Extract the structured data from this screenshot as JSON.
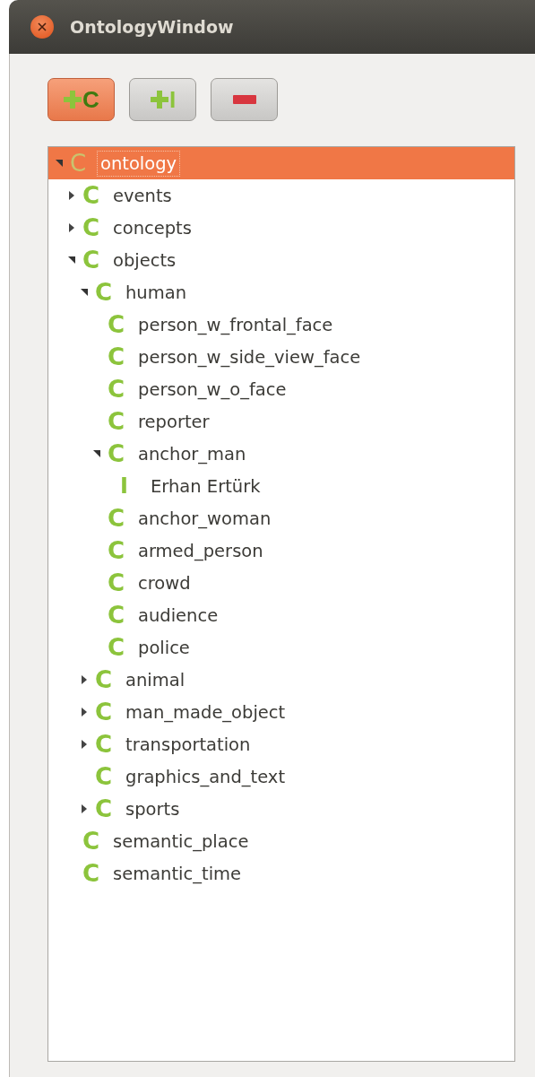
{
  "window": {
    "title": "OntologyWindow"
  },
  "toolbar": [
    {
      "kind": "add",
      "letter": "C",
      "selected": true
    },
    {
      "kind": "add",
      "letter": "I",
      "selected": false
    },
    {
      "kind": "remove",
      "selected": false
    }
  ],
  "tree": [
    {
      "icon": "C",
      "label": "ontology",
      "selected": true,
      "expanded": true,
      "children": [
        {
          "icon": "C",
          "label": "events",
          "selected": false,
          "expanded": false
        },
        {
          "icon": "C",
          "label": "concepts",
          "selected": false,
          "expanded": false
        },
        {
          "icon": "C",
          "label": "objects",
          "selected": false,
          "expanded": true,
          "children": [
            {
              "icon": "C",
              "label": "human",
              "selected": false,
              "expanded": true,
              "children": [
                {
                  "icon": "C",
                  "label": "person_w_frontal_face",
                  "selected": false
                },
                {
                  "icon": "C",
                  "label": "person_w_side_view_face",
                  "selected": false
                },
                {
                  "icon": "C",
                  "label": "person_w_o_face",
                  "selected": false
                },
                {
                  "icon": "C",
                  "label": "reporter",
                  "selected": false
                },
                {
                  "icon": "C",
                  "label": "anchor_man",
                  "selected": false,
                  "expanded": true,
                  "children": [
                    {
                      "icon": "I",
                      "label": "Erhan Ertürk",
                      "selected": false
                    }
                  ]
                },
                {
                  "icon": "C",
                  "label": "anchor_woman",
                  "selected": false
                },
                {
                  "icon": "C",
                  "label": "armed_person",
                  "selected": false
                },
                {
                  "icon": "C",
                  "label": "crowd",
                  "selected": false
                },
                {
                  "icon": "C",
                  "label": "audience",
                  "selected": false
                },
                {
                  "icon": "C",
                  "label": "police",
                  "selected": false
                }
              ]
            },
            {
              "icon": "C",
              "label": "animal",
              "selected": false,
              "expanded": false
            },
            {
              "icon": "C",
              "label": "man_made_object",
              "selected": false,
              "expanded": false
            },
            {
              "icon": "C",
              "label": "transportation",
              "selected": false,
              "expanded": false
            },
            {
              "icon": "C",
              "label": "graphics_and_text",
              "selected": false
            },
            {
              "icon": "C",
              "label": "sports",
              "selected": false,
              "expanded": false
            }
          ]
        },
        {
          "icon": "C",
          "label": "semantic_place",
          "selected": false
        },
        {
          "icon": "C",
          "label": "semantic_time",
          "selected": false
        }
      ]
    }
  ]
}
